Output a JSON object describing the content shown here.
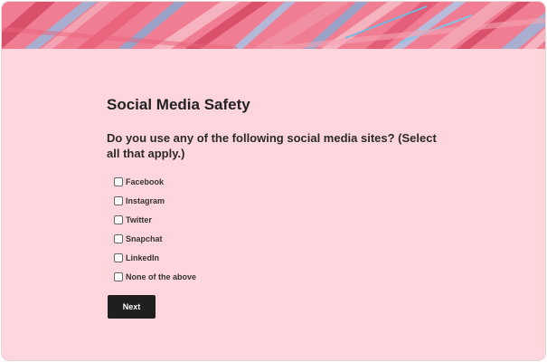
{
  "survey": {
    "title": "Social Media Safety",
    "question": "Do you use any of the following social media sites? (Select all that apply.)",
    "options": [
      {
        "label": "Facebook",
        "checked": false
      },
      {
        "label": "Instagram",
        "checked": false
      },
      {
        "label": "Twitter",
        "checked": false
      },
      {
        "label": "Snapchat",
        "checked": false
      },
      {
        "label": "LinkedIn",
        "checked": false
      },
      {
        "label": "None of the above",
        "checked": false
      }
    ],
    "next_label": "Next"
  },
  "colors": {
    "page_background": "#ffd6de",
    "banner_primary": "#ee6e86",
    "banner_accent": "#9aa2c8",
    "button_background": "#1f1f1f",
    "button_text": "#ffffff"
  }
}
